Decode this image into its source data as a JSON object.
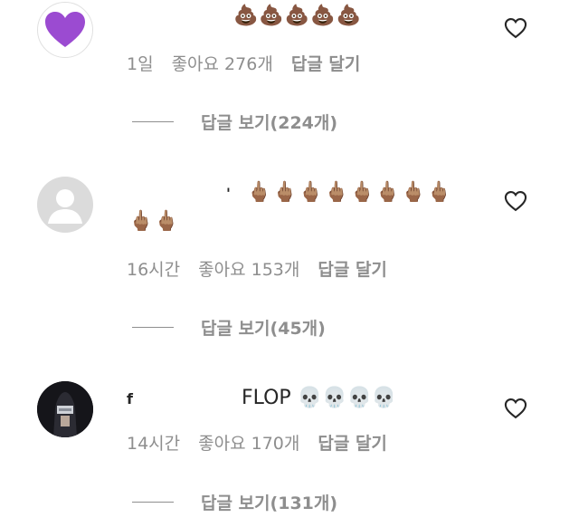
{
  "comments": [
    {
      "avatar": "purple-heart",
      "text": "💩💩💩💩💩",
      "time": "1일",
      "likes": "좋아요 276개",
      "reply_label": "답글 달기",
      "view_replies": "답글 보기(224개)",
      "like_icon": "heart-outline-icon"
    },
    {
      "avatar": "default-profile",
      "username": "'",
      "text": "🖕🏽🖕🏽🖕🏽🖕🏽🖕🏽🖕🏽🖕🏽🖕🏽",
      "text2": "🖕🏽🖕🏽",
      "time": "16시간",
      "likes": "좋아요 153개",
      "reply_label": "답글 달기",
      "view_replies": "답글 보기(45개)",
      "like_icon": "heart-outline-icon"
    },
    {
      "avatar": "user-photo",
      "username": "f",
      "text": "FLOP 💀💀💀💀",
      "time": "14시간",
      "likes": "좋아요 170개",
      "reply_label": "답글 달기",
      "view_replies": "답글 보기(131개)",
      "like_icon": "heart-outline-icon"
    }
  ],
  "colors": {
    "meta": "#8e8e8e",
    "text": "#262626",
    "heart": "#9b4bd1"
  }
}
